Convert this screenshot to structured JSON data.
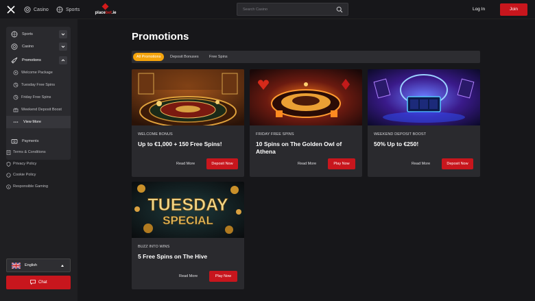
{
  "header": {
    "nav": [
      {
        "label": "Casino",
        "icon": "casino-chip-icon"
      },
      {
        "label": "Sports",
        "icon": "sports-ball-icon"
      }
    ],
    "logo": {
      "part1": "place",
      "part2": "bet",
      "part3": ".ie"
    },
    "search_placeholder": "Search Casino",
    "login_label": "Log In",
    "join_label": "Join"
  },
  "sidebar": {
    "items": [
      {
        "label": "Sports",
        "icon": "sports-ball-icon"
      },
      {
        "label": "Casino",
        "icon": "casino-chip-icon"
      },
      {
        "label": "Promotions",
        "icon": "rocket-icon"
      }
    ],
    "promo_sub": [
      {
        "label": "Welcome Package"
      },
      {
        "label": "Tuesday Free Spins"
      },
      {
        "label": "Friday Free Spins"
      },
      {
        "label": "Weekend Deposit Boost"
      }
    ],
    "view_more": "View More",
    "payments": "Payments",
    "links": [
      {
        "label": "Terms & Conditions"
      },
      {
        "label": "Privacy Policy"
      },
      {
        "label": "Cookie Policy"
      },
      {
        "label": "Responsible Gaming"
      }
    ],
    "language": "English",
    "chat": "Chat"
  },
  "main": {
    "title": "Promotions",
    "filters": [
      "All Promotions",
      "Deposit Bonuses",
      "Free Spins"
    ],
    "active_filter": "All Promotions",
    "cards": [
      {
        "tag": "WELCOME BONUS",
        "title": "Up to €1,000 + 150 Free Spins!",
        "more": "Read More",
        "cta": "Deposit Now"
      },
      {
        "tag": "FRIDAY FREE SPINS",
        "title": "10 Spins on The Golden Owl of Athena",
        "more": "Read More",
        "cta": "Play Now"
      },
      {
        "tag": "WEEKEND DEPOSIT BOOST",
        "title": "50% Up to €250!",
        "more": "Read More",
        "cta": "Deposit Now"
      },
      {
        "tag": "BUZZ INTO WINS",
        "title": "5 Free Spins on The Hive",
        "more": "Read More",
        "cta": "Play Now",
        "image_text": [
          "TUESDAY",
          "SPECIAL"
        ]
      }
    ]
  },
  "colors": {
    "accent": "#c8161d",
    "active_filter": "#f5a40c",
    "background": "#17171a",
    "panel": "#2a2a2e"
  }
}
